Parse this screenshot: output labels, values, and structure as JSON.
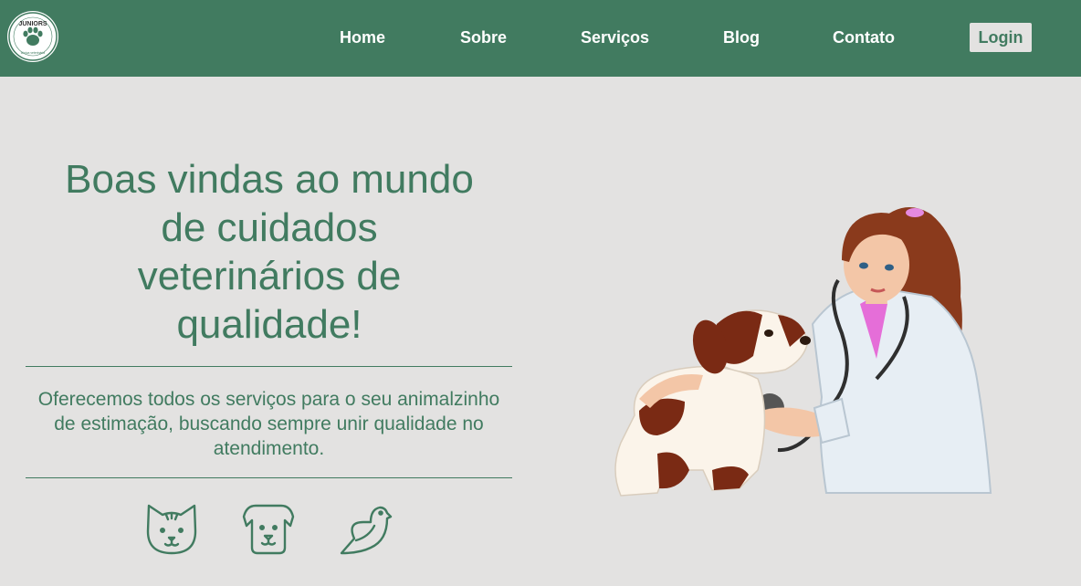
{
  "header": {
    "logo": {
      "text": "JUNIORS",
      "subtext": "clínica veterinária"
    },
    "nav": [
      {
        "label": "Home"
      },
      {
        "label": "Sobre"
      },
      {
        "label": "Serviços"
      },
      {
        "label": "Blog"
      },
      {
        "label": "Contato"
      }
    ],
    "login_label": "Login"
  },
  "hero": {
    "title": "Boas vindas ao mundo de cuidados veterinários de qualidade!",
    "description": "Oferecemos todos os serviços para o seu animalzinho de estimação, buscando sempre unir qualidade no atendimento.",
    "icons": [
      "cat-icon",
      "dog-icon",
      "bird-icon"
    ]
  },
  "colors": {
    "primary": "#417b60",
    "background": "#e3e2e1",
    "nav_text": "#ffffff"
  }
}
